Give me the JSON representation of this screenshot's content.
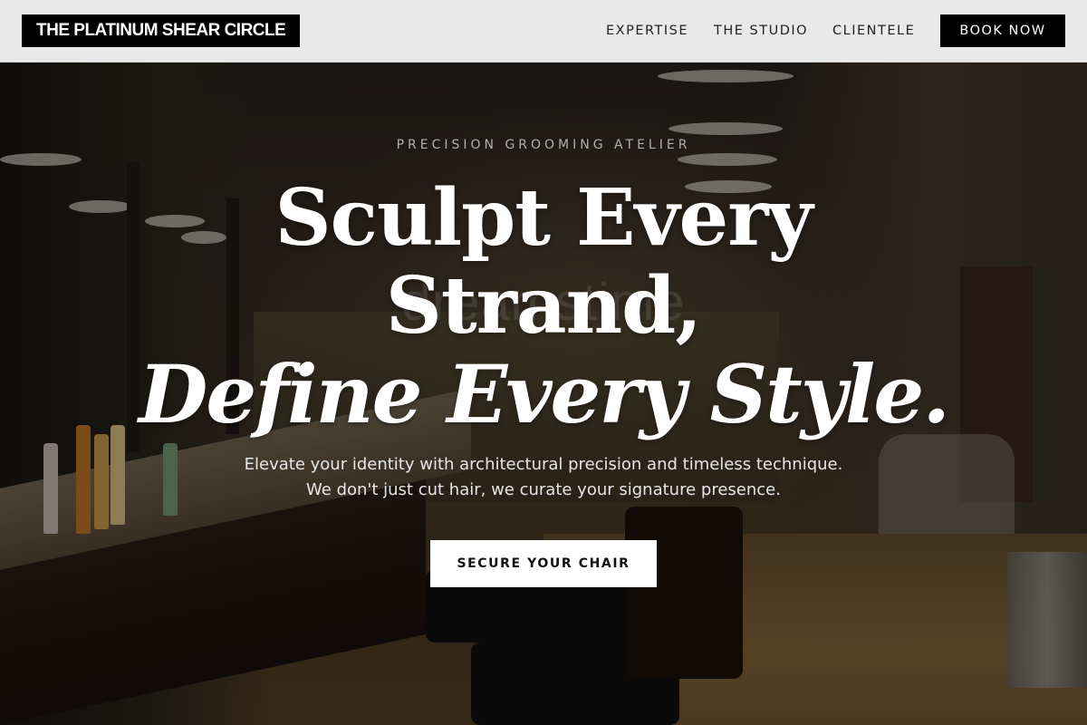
{
  "header": {
    "logo": "THE PLATINUM SHEAR CIRCLE",
    "nav": [
      "EXPERTISE",
      "THE STUDIO",
      "CLIENTELE"
    ],
    "book_label": "BOOK NOW"
  },
  "hero": {
    "eyebrow": "PRECISION GROOMING ATELIER",
    "headline_line1": "Sculpt Every",
    "headline_line2": "Strand,",
    "headline_line3": "Define Every Style.",
    "sub_line1": "Elevate your identity with architectural precision and timeless technique.",
    "sub_line2": "We don't just cut hair, we curate your signature presence.",
    "cta_label": "SECURE YOUR CHAIR",
    "watermark": "dreamstime"
  },
  "colors": {
    "header_bg": "#e9e9e9",
    "dark": "#000000",
    "light": "#ffffff"
  }
}
